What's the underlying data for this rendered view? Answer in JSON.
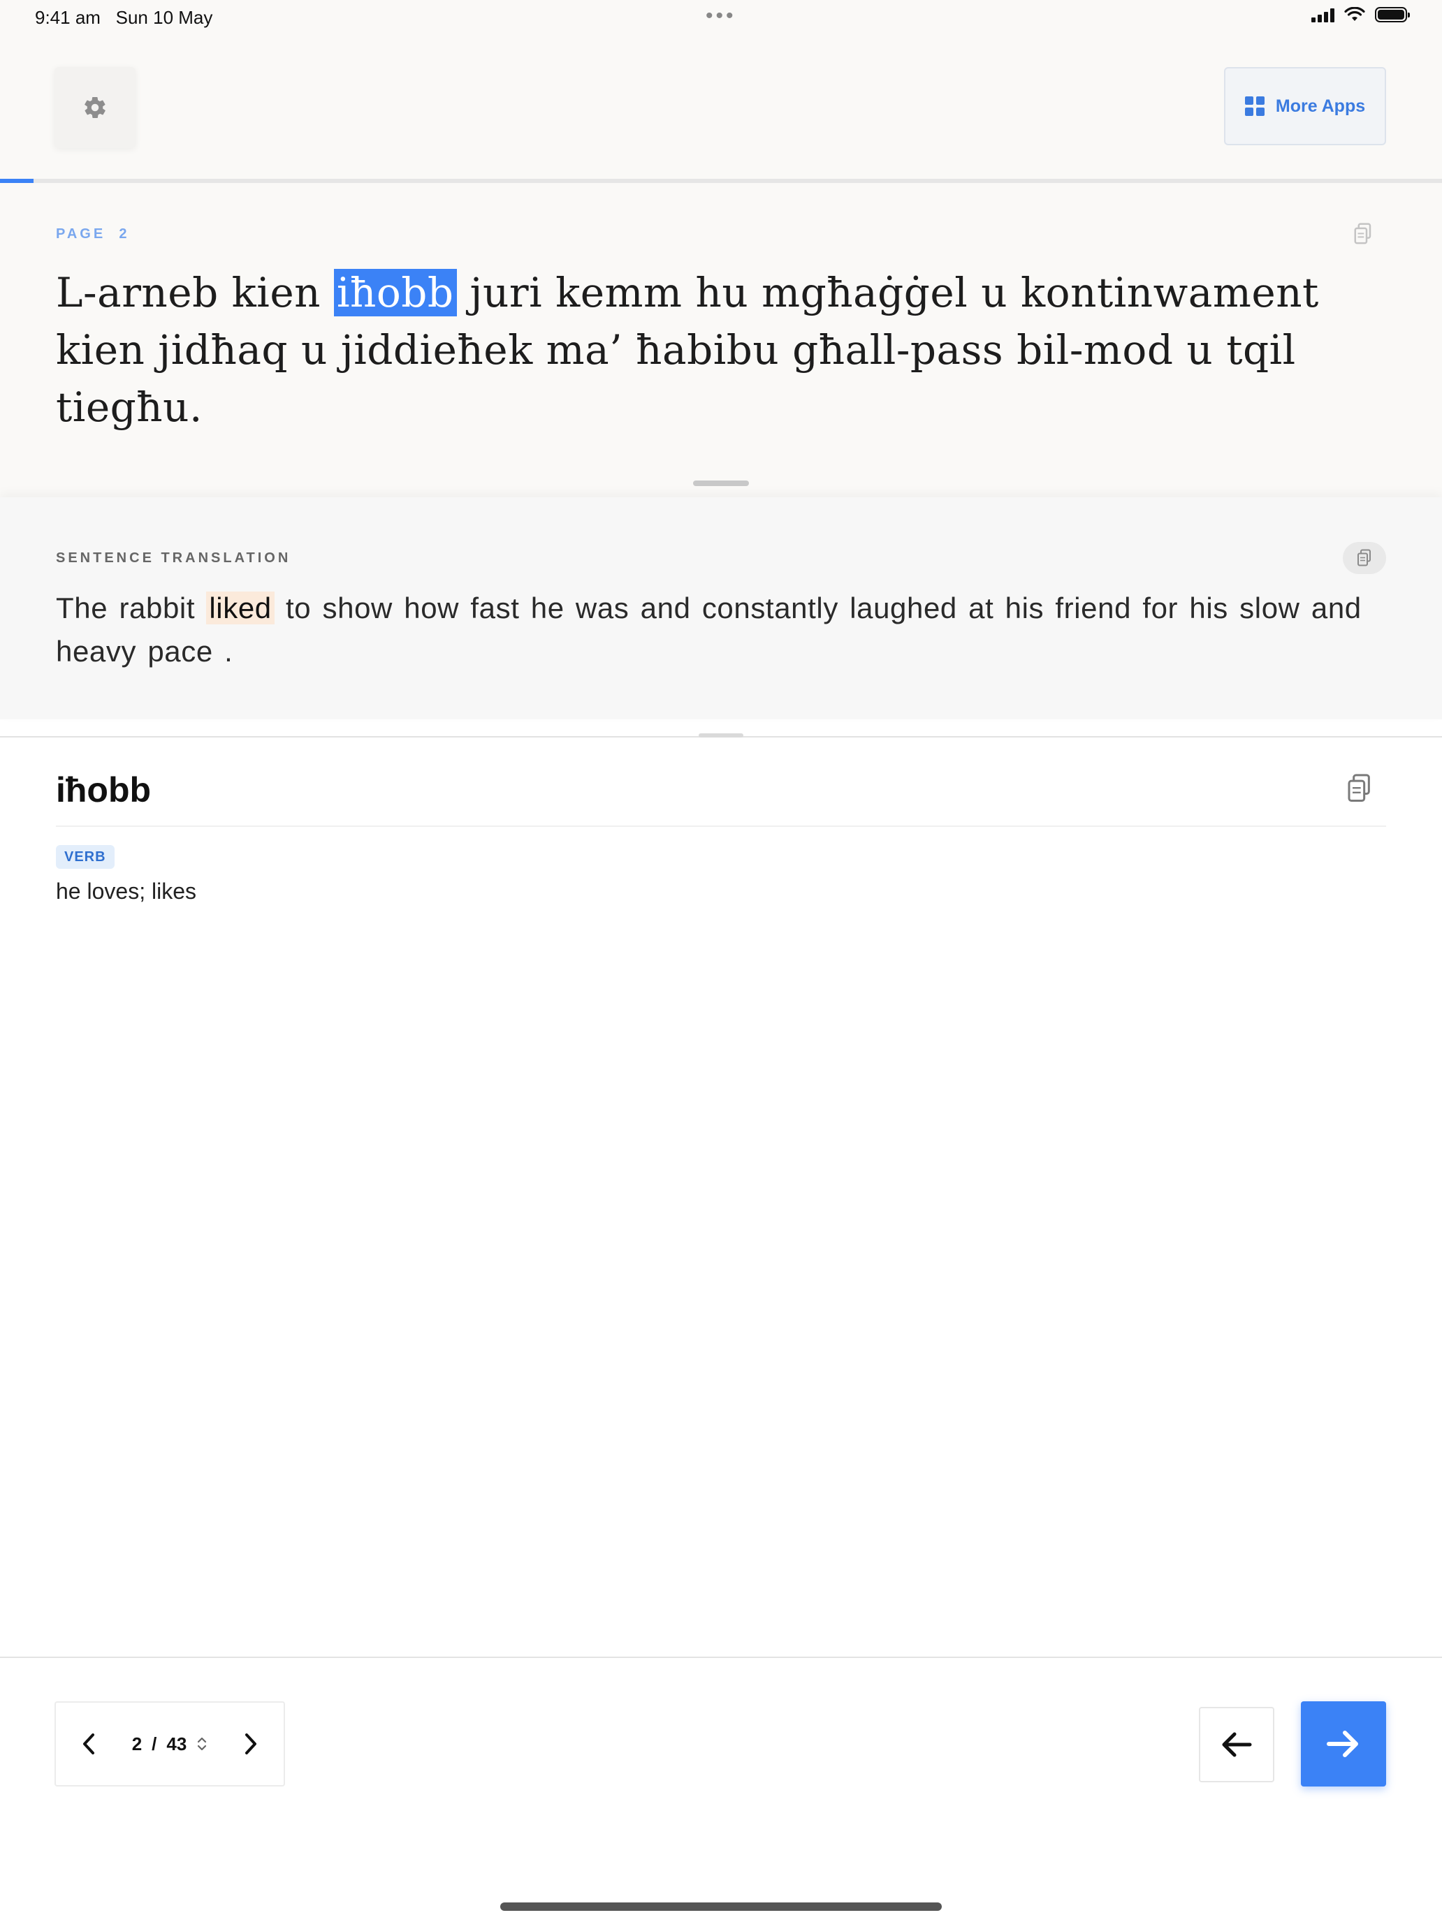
{
  "status_bar": {
    "time": "9:41 am",
    "date": "Sun 10 May",
    "dots": "•••"
  },
  "header": {
    "settings_icon": "gear-icon",
    "more_apps_label": "More Apps",
    "more_apps_icon": "grid-icon",
    "accent_color": "#3b82f6"
  },
  "progress": {
    "current_page": 2,
    "total_pages": 43,
    "fraction": 0.0465
  },
  "source": {
    "page_label": "PAGE",
    "page_number": "2",
    "text_before": "L-arneb kien ",
    "highlight": "iħobb",
    "text_after": " juri kemm hu mgħaġġel u kontinwament kien jidħaq u jiddieħek ma’ ħabibu għall-pass bil-mod u tqil tiegħu.",
    "copy_icon": "copy-icon"
  },
  "translation": {
    "label": "SENTENCE TRANSLATION",
    "text_before": "The rabbit ",
    "highlight": "liked",
    "text_after": " to show how fast he was and constantly laughed at his friend for his slow and heavy pace .",
    "copy_icon": "copy-icon"
  },
  "dictionary": {
    "word": "iħobb",
    "part_of_speech": "VERB",
    "definition": "he loves; likes",
    "copy_icon": "copy-icon"
  },
  "pager": {
    "current": "2",
    "separator": "/",
    "total": "43",
    "prev_icon": "chevron-left-icon",
    "next_icon": "chevron-right-icon",
    "stepper_icon": "up-down-chevron-icon"
  },
  "navigation": {
    "prev_icon": "arrow-left-icon",
    "next_icon": "arrow-right-icon"
  }
}
